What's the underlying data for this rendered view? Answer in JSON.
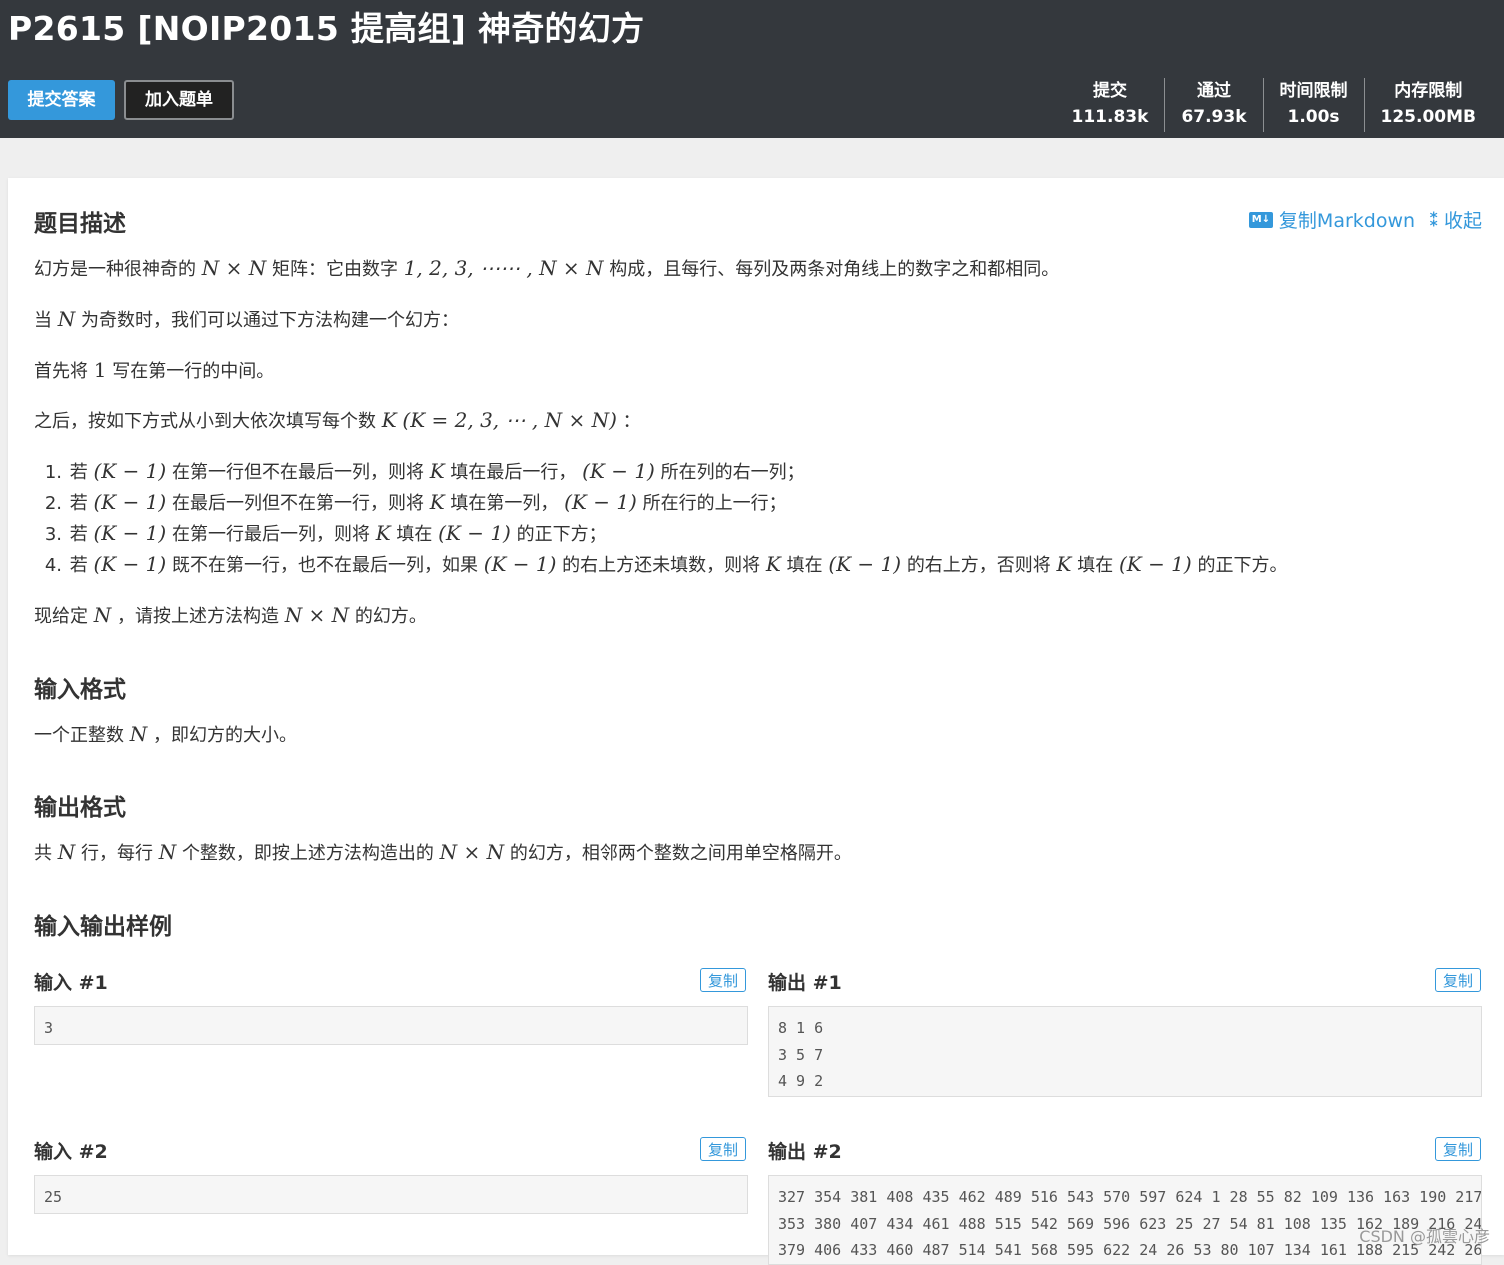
{
  "header": {
    "title": "P2615 [NOIP2015 提高组] 神奇的幻方",
    "submit_label": "提交答案",
    "add_label": "加入题单",
    "stats": [
      {
        "label": "提交",
        "value": "111.83k"
      },
      {
        "label": "通过",
        "value": "67.93k"
      },
      {
        "label": "时间限制",
        "value": "1.00s"
      },
      {
        "label": "内存限制",
        "value": "125.00MB"
      }
    ]
  },
  "tools": {
    "copy_markdown": "复制Markdown",
    "collapse": "收起",
    "md_icon_text": "M↓",
    "collapse_icon_text": "⁑"
  },
  "description": {
    "heading": "题目描述",
    "p1": {
      "a": "幻方是一种很神奇的",
      "b": "矩阵：它由数字",
      "c": "构成，且每行、每列及两条对角线上的数字之和都相同。"
    },
    "p2": {
      "a": "当",
      "b": "为奇数时，我们可以通过下方法构建一个幻方："
    },
    "p3": {
      "a": "首先将",
      "b": "写在第一行的中间。"
    },
    "p4": {
      "a": "之后，按如下方式从小到大依次填写每个数",
      "b": "："
    },
    "rules": [
      {
        "num": "1.",
        "t1": "若",
        "t2": "在第一行但不在最后一列，则将",
        "t3": "填在最后一行，",
        "t4": "所在列的右一列；"
      },
      {
        "num": "2.",
        "t1": "若",
        "t2": "在最后一列但不在第一行，则将",
        "t3": "填在第一列，",
        "t4": "所在行的上一行；"
      },
      {
        "num": "3.",
        "t1": "若",
        "t2": "在第一行最后一列，则将",
        "t3": "填在",
        "t4": "的正下方；"
      },
      {
        "num": "4.",
        "t1": "若",
        "t2": "既不在第一行，也不在最后一列，如果",
        "t3": "的右上方还未填数，则将",
        "t4": "填在",
        "t5": "的右上方，否则将",
        "t6": "填在",
        "t7": "的正下方。"
      }
    ],
    "p5": {
      "a": "现给定",
      "b": "，请按上述方法构造",
      "c": "的幻方。"
    }
  },
  "math": {
    "N": "N",
    "NxN": "N × N",
    "seq": "1, 2, 3, ⋯⋯ , N × N",
    "one": "1",
    "K": "K",
    "Krange": "(K = 2, 3, ⋯ , N × N)",
    "Km1": "(K − 1)"
  },
  "input_format": {
    "heading": "输入格式",
    "a": "一个正整数",
    "b": "，即幻方的大小。"
  },
  "output_format": {
    "heading": "输出格式",
    "a": "共",
    "b": "行，每行",
    "c": "个整数，即按上述方法构造出的",
    "d": "的幻方，相邻两个整数之间用单空格隔开。"
  },
  "samples": {
    "heading": "输入输出样例",
    "copy_label": "复制",
    "items": [
      {
        "in_label": "输入 #1",
        "out_label": "输出 #1",
        "input": "3",
        "output": "8 1 6\n3 5 7\n4 9 2"
      },
      {
        "in_label": "输入 #2",
        "out_label": "输出 #2",
        "input": "25",
        "output": "327 354 381 408 435 462 489 516 543 570 597 624 1 28 55 82 109 136 163 190 217\n353 380 407 434 461 488 515 542 569 596 623 25 27 54 81 108 135 162 189 216 24\n379 406 433 460 487 514 541 568 595 622 24 26 53 80 107 134 161 188 215 242 26"
      }
    ]
  },
  "watermark": "CSDN @孤雲心彦"
}
